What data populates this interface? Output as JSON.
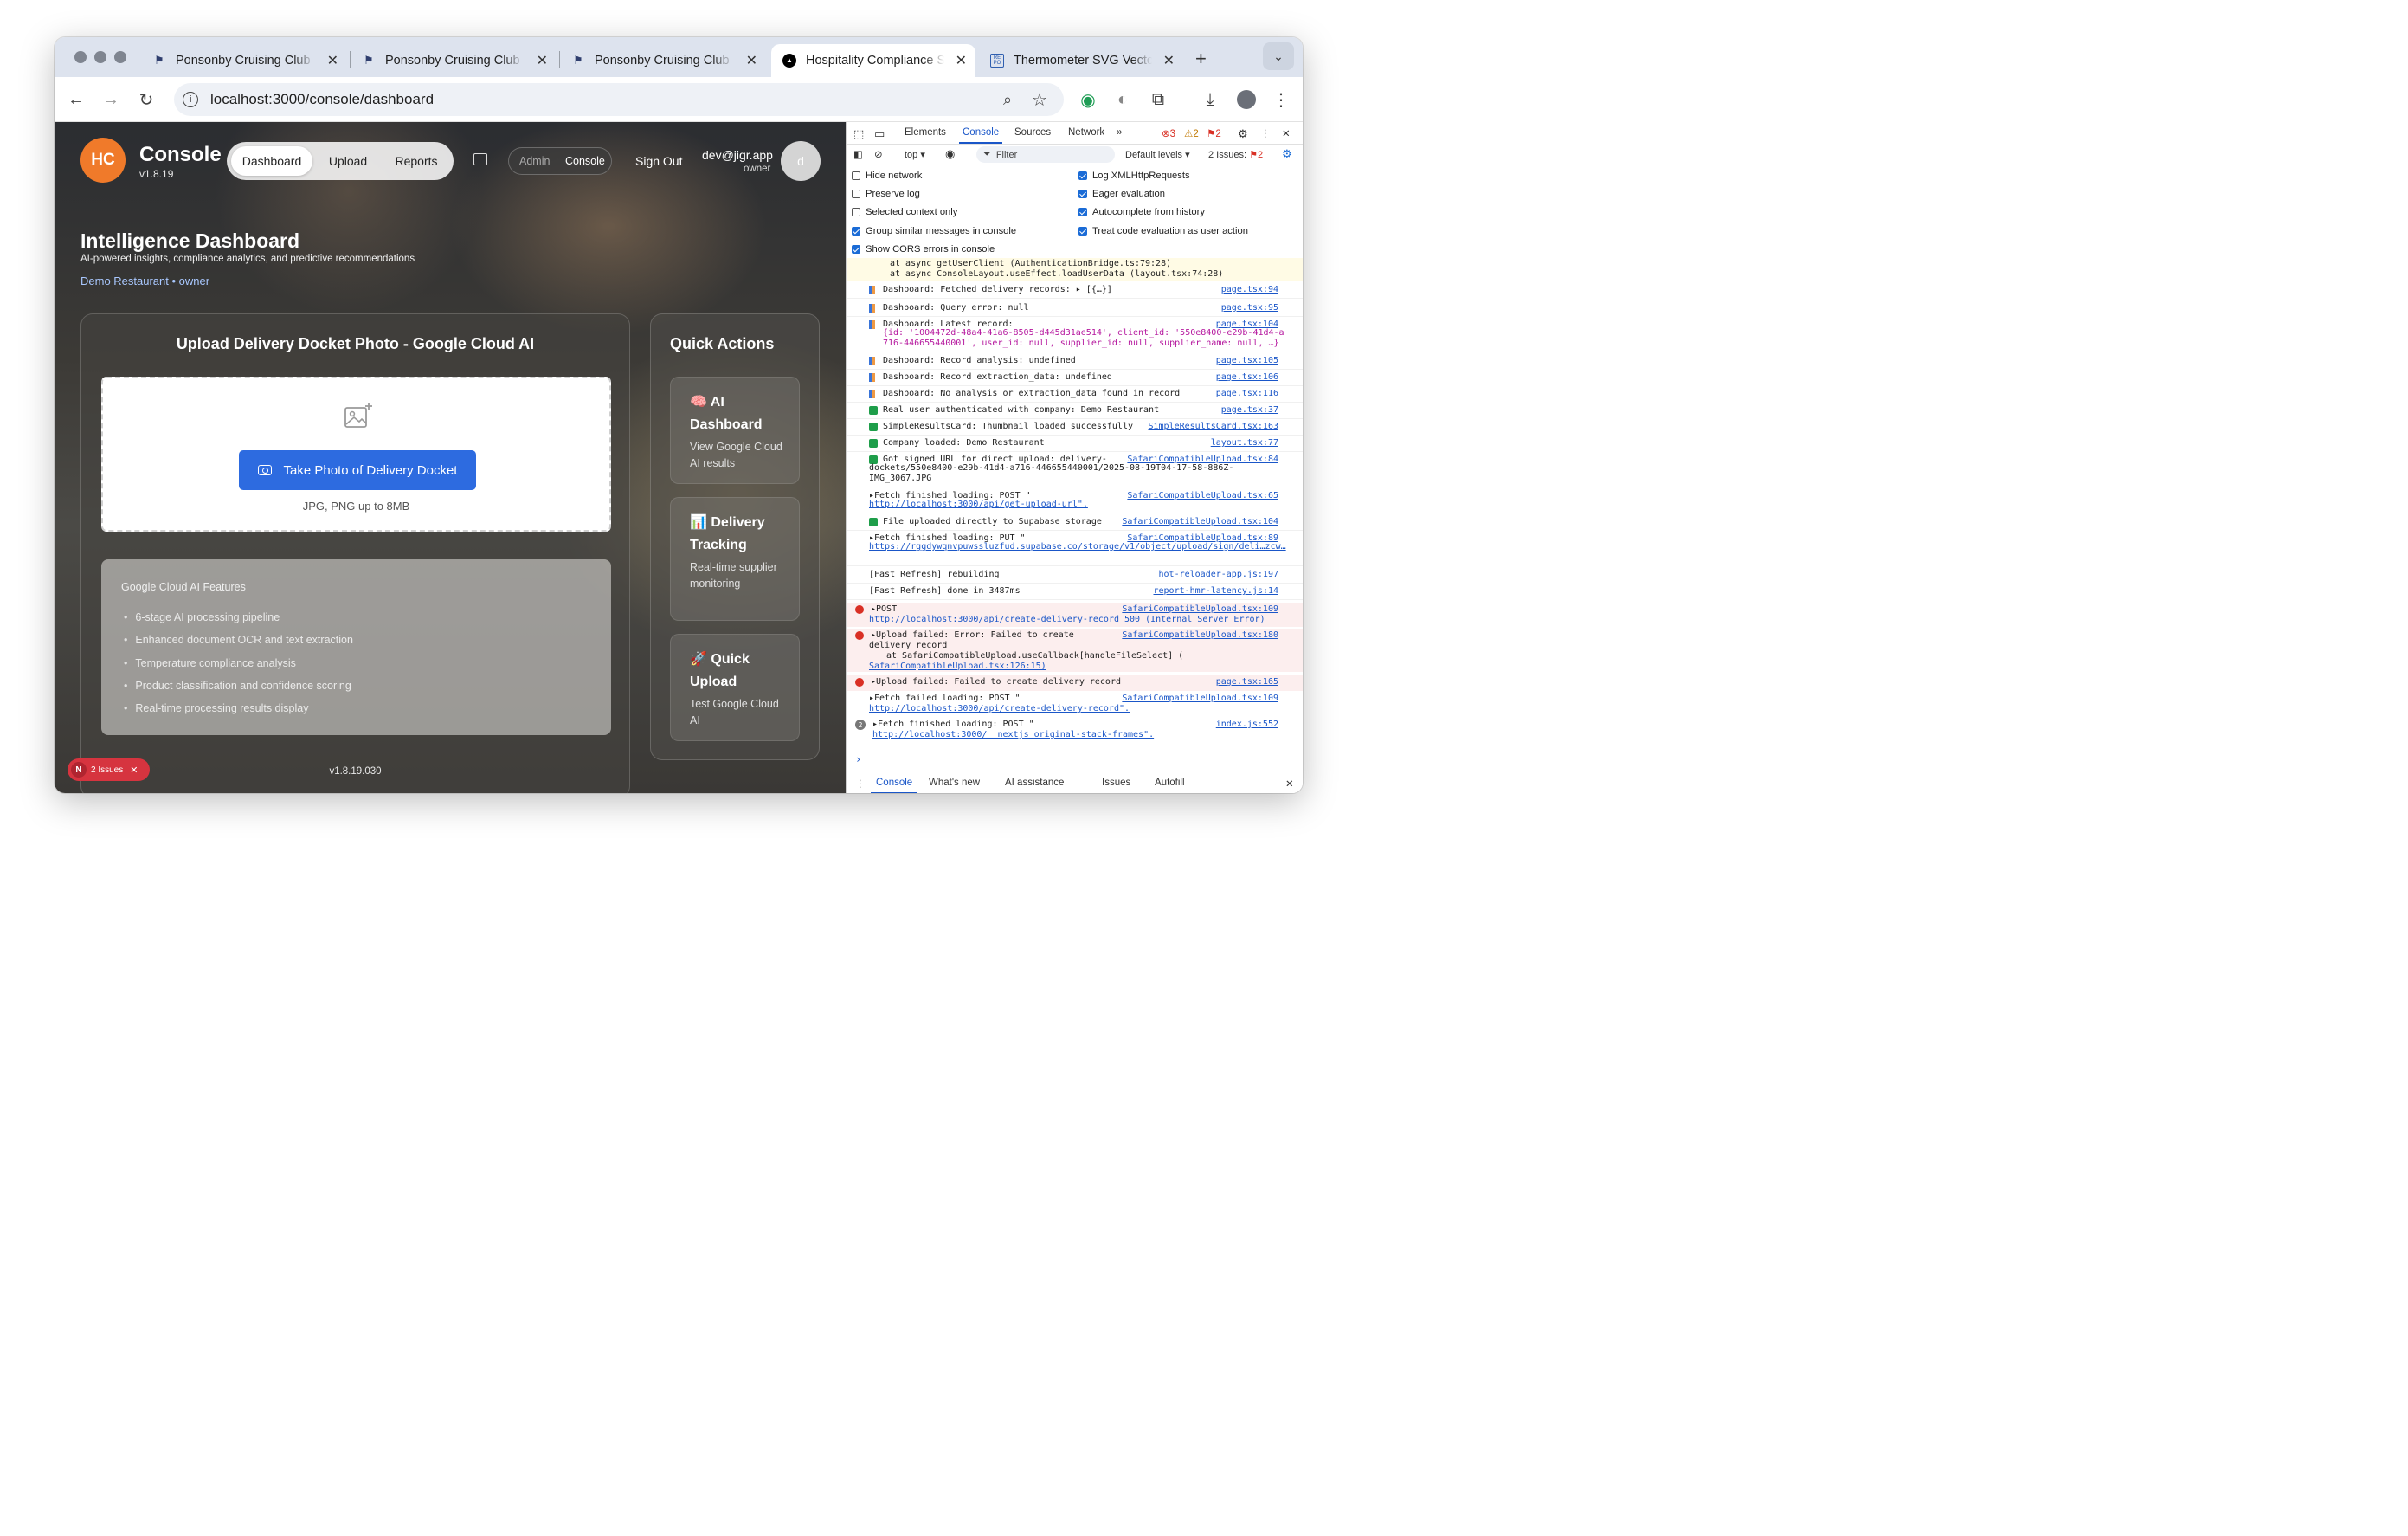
{
  "browser": {
    "tabs": [
      {
        "title": "Ponsonby Cruising Club -"
      },
      {
        "title": "Ponsonby Cruising Club -"
      },
      {
        "title": "Ponsonby Cruising Club -"
      },
      {
        "title": "Hospitality Compliance S"
      },
      {
        "title": "Thermometer SVG Vector"
      }
    ],
    "url": "localhost:3000/console/dashboard"
  },
  "app": {
    "logo": "HC",
    "title": "Console",
    "version": "v1.8.19",
    "nav": [
      "Dashboard",
      "Upload",
      "Reports"
    ],
    "roles": [
      "Admin",
      "Console"
    ],
    "sign_out": "Sign Out",
    "user_email": "dev@jigr.app",
    "user_role": "owner",
    "avatar_letter": "d",
    "dashboard_title": "Intelligence Dashboard",
    "dashboard_subtitle": "AI-powered insights, compliance analytics, and predictive recommendations",
    "company": "Demo Restaurant",
    "company_role": "owner"
  },
  "upload": {
    "title": "Upload Delivery Docket Photo - Google Cloud AI",
    "button": "Take Photo of Delivery Docket",
    "hint": "JPG, PNG up to 8MB",
    "features_title": "Google Cloud AI Features",
    "features": [
      "6-stage AI processing pipeline",
      "Enhanced document OCR and text extraction",
      "Temperature compliance analysis",
      "Product classification and confidence scoring",
      "Real-time processing results display"
    ],
    "version": "v1.8.19.030"
  },
  "quick_actions": {
    "title": "Quick Actions",
    "items": [
      {
        "emoji": "🧠",
        "title": "AI Dashboard",
        "desc": "View Google Cloud AI results"
      },
      {
        "emoji": "📊",
        "title": "Delivery Tracking",
        "desc": "Real-time supplier monitoring"
      },
      {
        "emoji": "🚀",
        "title": "Quick Upload",
        "desc": "Test Google Cloud AI"
      }
    ]
  },
  "issues_badge": {
    "letter": "N",
    "label": "2 Issues"
  },
  "devtools": {
    "tabs": [
      "Elements",
      "Console",
      "Sources",
      "Network"
    ],
    "error_count": "3",
    "warn_count": "2",
    "issue_count": "2",
    "context": "top",
    "filter_placeholder": "Filter",
    "levels": "Default levels",
    "issues_label": "2 Issues:",
    "issues_num": "2",
    "options_left": [
      {
        "label": "Hide network",
        "checked": false
      },
      {
        "label": "Preserve log",
        "checked": false
      },
      {
        "label": "Selected context only",
        "checked": false
      },
      {
        "label": "Group similar messages in console",
        "checked": true
      },
      {
        "label": "Show CORS errors in console",
        "checked": true
      }
    ],
    "options_right": [
      {
        "label": "Log XMLHttpRequests",
        "checked": true
      },
      {
        "label": "Eager evaluation",
        "checked": true
      },
      {
        "label": "Autocomplete from history",
        "checked": true
      },
      {
        "label": "Treat code evaluation as user action",
        "checked": true
      }
    ],
    "stack_lines": [
      "at async getUserClient (AuthenticationBridge.ts:79:28)",
      "at async ConsoleLayout.useEffect.loadUserData (layout.tsx:74:28)"
    ],
    "logs": [
      {
        "icon": "bar",
        "msg": "Dashboard: Fetched delivery records:  ▸ [{…}]",
        "src": "page.tsx:94"
      },
      {
        "icon": "bar",
        "msg": "Dashboard: Query error: null",
        "src": "page.tsx:95"
      },
      {
        "icon": "bar",
        "msg": "Dashboard: Latest record:",
        "src": "page.tsx:104"
      },
      {
        "icon": "bar",
        "msg": "Dashboard: Record analysis: undefined",
        "src": "page.tsx:105"
      },
      {
        "icon": "bar",
        "msg": "Dashboard: Record extraction_data: undefined",
        "src": "page.tsx:106"
      },
      {
        "icon": "bar",
        "msg": "Dashboard: No analysis or extraction_data found in record",
        "src": "page.tsx:116"
      },
      {
        "icon": "ok",
        "msg": "Real user authenticated with company: Demo Restaurant",
        "src": "page.tsx:37"
      },
      {
        "icon": "ok",
        "msg": "SimpleResultsCard: Thumbnail loaded successfully",
        "src": "SimpleResultsCard.tsx:163"
      },
      {
        "icon": "ok",
        "msg": "Company loaded: Demo Restaurant",
        "src": "layout.tsx:77"
      },
      {
        "icon": "ok",
        "msg": "Got signed URL for direct upload: delivery-",
        "src": "SafariCompatibleUpload.tsx:84"
      },
      {
        "icon": "none",
        "msg": "▸Fetch finished loading: POST \"",
        "src": "SafariCompatibleUpload.tsx:65"
      },
      {
        "icon": "ok",
        "msg": "File uploaded directly to Supabase storage",
        "src": "SafariCompatibleUpload.tsx:104"
      },
      {
        "icon": "none",
        "msg": "▸Fetch finished loading: PUT \"",
        "src": "SafariCompatibleUpload.tsx:89"
      },
      {
        "icon": "none",
        "msg": "[Fast Refresh] rebuilding",
        "src": "hot-reloader-app.js:197"
      },
      {
        "icon": "none",
        "msg": "[Fast Refresh] done in 3487ms",
        "src": "report-hmr-latency.js:14"
      }
    ],
    "latest_record_1": "{id: '1004472d-48a4-41a6-8505-d445d31ae514', client_id: '550e8400-e29b-41d4-a",
    "latest_record_2": "716-446655440001', user_id: null, supplier_id: null, supplier_name: null, …}",
    "signed_url_1": "dockets/550e8400-e29b-41d4-a716-446655440001/2025-08-19T04-17-58-886Z-",
    "signed_url_2": "IMG_3067.JPG",
    "fetch_url_1": "http://localhost:3000/api/get-upload-url\".",
    "fetch_url_2": "https://rggdywqnvpuwssluzfud.supabase.co/storage/v1/object/upload/sign/deli…zcw…",
    "errors": [
      {
        "msg": "▸POST",
        "src": "SafariCompatibleUpload.tsx:109",
        "line2": "http://localhost:3000/api/create-delivery-record 500 (Internal Server Error)"
      },
      {
        "msg": "▸Upload failed: Error: Failed to create",
        "src": "SafariCompatibleUpload.tsx:180",
        "line2": "delivery record",
        "line3": "at SafariCompatibleUpload.useCallback[handleFileSelect] (",
        "line4": "SafariCompatibleUpload.tsx:126:15)"
      },
      {
        "msg": "▸Upload failed: Failed to create delivery record",
        "src": "page.tsx:165"
      }
    ],
    "fetch_failed": {
      "msg": "▸Fetch failed loading: POST \"",
      "src": "SafariCompatibleUpload.tsx:109",
      "line2": "http://localhost:3000/api/create-delivery-record\"."
    },
    "fetch_final": {
      "count": "2",
      "msg": "▸Fetch finished loading: POST \"",
      "src": "index.js:552",
      "line2": "http://localhost:3000/__nextjs_original-stack-frames\"."
    },
    "bottom_tabs": [
      "Console",
      "What's new",
      "AI assistance",
      "Issues",
      "Autofill"
    ]
  }
}
